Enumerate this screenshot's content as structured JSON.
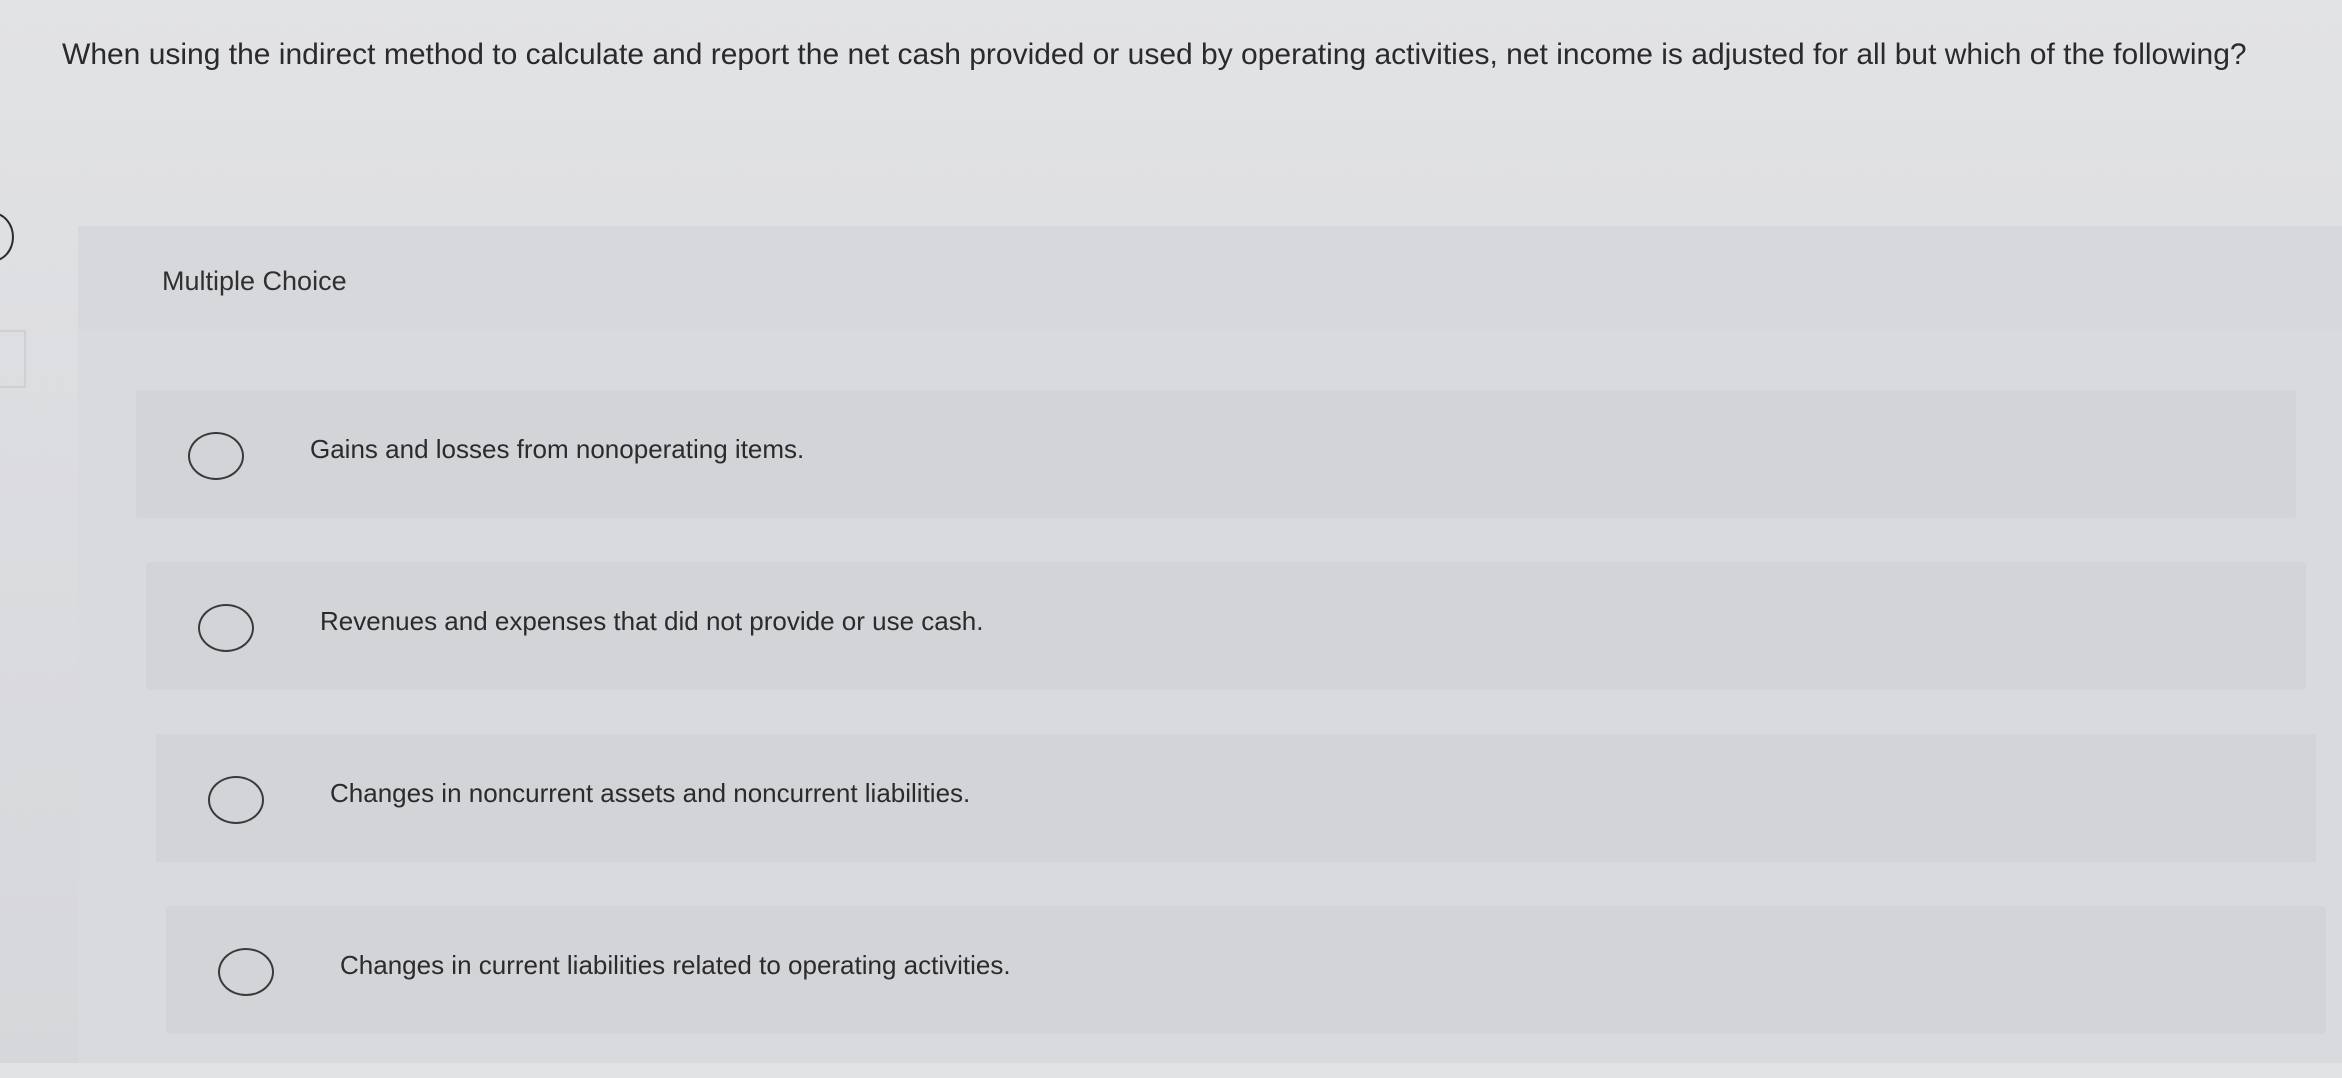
{
  "question": {
    "text": "When using the indirect method to calculate and report the net cash provided or used by operating activities, net income is adjusted for all but which of the following?"
  },
  "section": {
    "label": "Multiple Choice"
  },
  "options": [
    {
      "text": "Gains and losses from nonoperating items.",
      "selected": false
    },
    {
      "text": "Revenues and expenses that did not provide or use cash.",
      "selected": false
    },
    {
      "text": "Changes in noncurrent assets and noncurrent liabilities.",
      "selected": false
    },
    {
      "text": "Changes in current liabilities related to operating activities.",
      "selected": false
    }
  ]
}
